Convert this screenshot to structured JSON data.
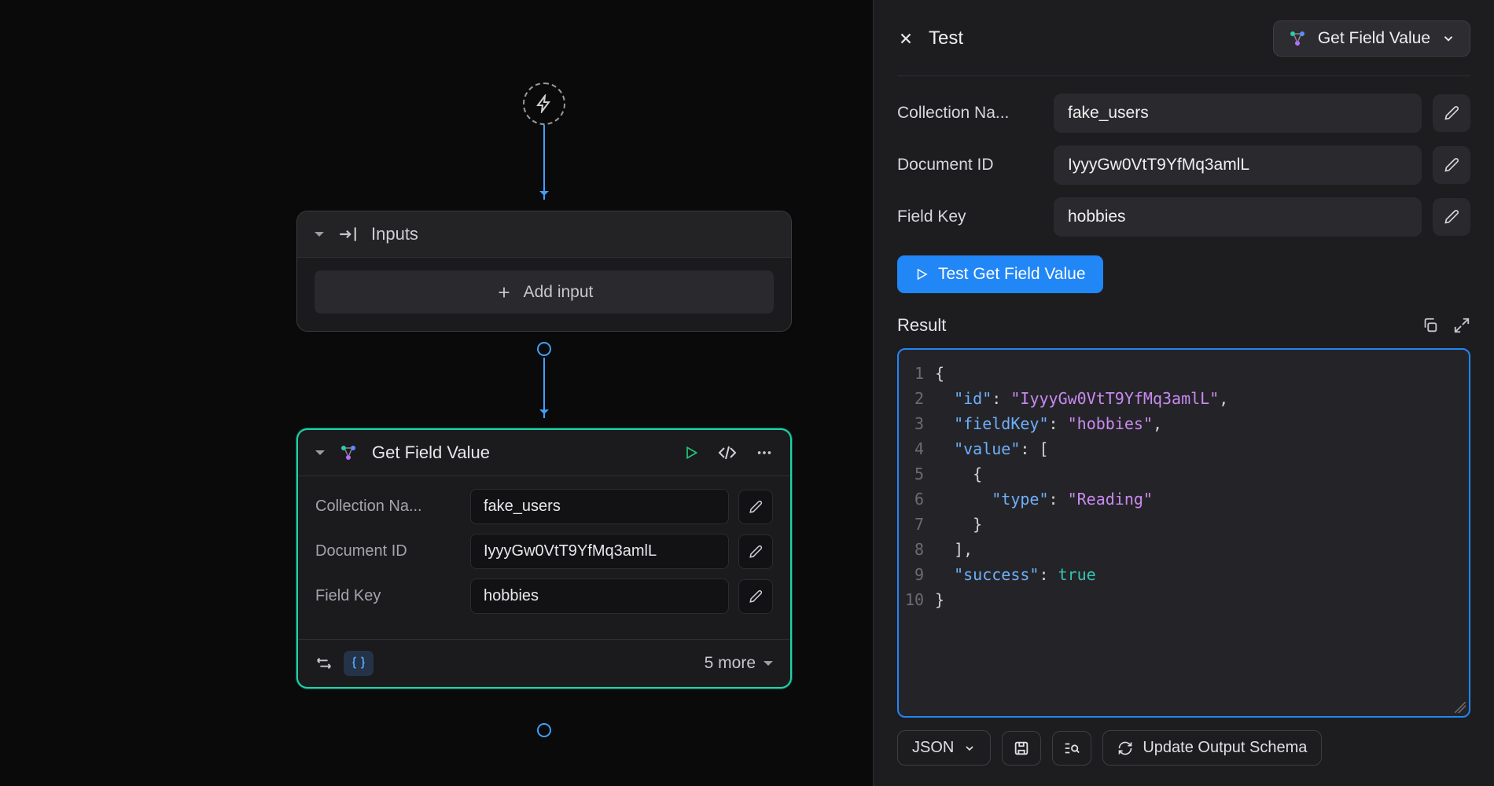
{
  "canvas": {
    "inputs_node": {
      "title": "Inputs",
      "add_label": "Add input"
    },
    "getfield_node": {
      "title": "Get Field Value",
      "fields": [
        {
          "label": "Collection Na...",
          "value": "fake_users"
        },
        {
          "label": "Document ID",
          "value": "IyyyGw0VtT9YfMq3amlL"
        },
        {
          "label": "Field Key",
          "value": "hobbies"
        }
      ],
      "more_label": "5 more"
    }
  },
  "panel": {
    "title": "Test",
    "selector_label": "Get Field Value",
    "fields": [
      {
        "label": "Collection Na...",
        "value": "fake_users"
      },
      {
        "label": "Document ID",
        "value": "IyyyGw0VtT9YfMq3amlL"
      },
      {
        "label": "Field Key",
        "value": "hobbies"
      }
    ],
    "test_button": "Test Get Field Value",
    "result_label": "Result",
    "result_json": {
      "id": "IyyyGw0VtT9YfMq3amlL",
      "fieldKey": "hobbies",
      "value": [
        {
          "type": "Reading"
        }
      ],
      "success": true
    },
    "output_format": "JSON",
    "update_schema": "Update Output Schema"
  }
}
